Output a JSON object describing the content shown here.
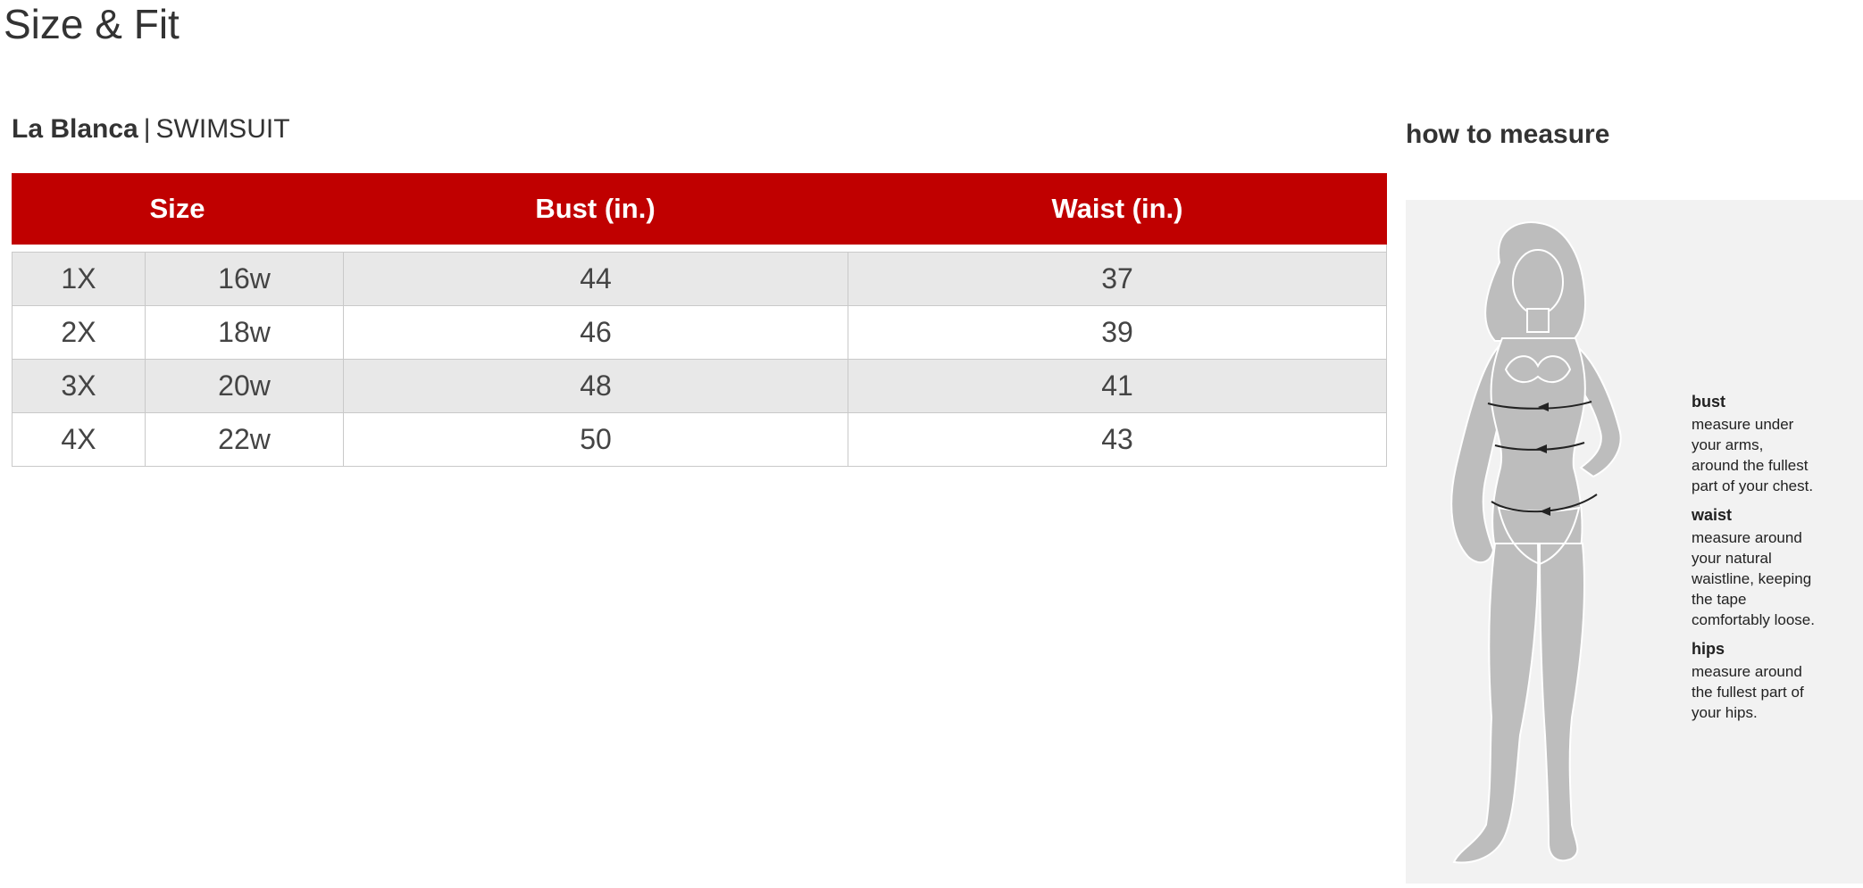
{
  "page": {
    "title": "Size & Fit"
  },
  "brand": {
    "name": "La Blanca",
    "separator": "|",
    "category": "SWIMSUIT"
  },
  "table": {
    "headers": {
      "size": "Size",
      "bust": "Bust (in.)",
      "waist": "Waist (in.)"
    },
    "rows": [
      {
        "size": "1X",
        "alt_size": "16w",
        "bust": "44",
        "waist": "37"
      },
      {
        "size": "2X",
        "alt_size": "18w",
        "bust": "46",
        "waist": "39"
      },
      {
        "size": "3X",
        "alt_size": "20w",
        "bust": "48",
        "waist": "41"
      },
      {
        "size": "4X",
        "alt_size": "22w",
        "bust": "50",
        "waist": "43"
      }
    ]
  },
  "measure": {
    "title": "how to measure",
    "notes": [
      {
        "heading": "bust",
        "text": "measure under\nyour arms,\naround the fullest\npart of your chest."
      },
      {
        "heading": "waist",
        "text": "measure around\nyour natural\nwaistline, keeping\nthe tape\ncomfortably loose."
      },
      {
        "heading": "hips",
        "text": "measure around\nthe fullest part of\nyour hips."
      }
    ]
  },
  "colors": {
    "header_bg": "#c00000",
    "header_text": "#ffffff",
    "row_shade": "#e8e8e8",
    "figure": "#bdbdbd",
    "panel_bg": "#f2f2f2"
  }
}
